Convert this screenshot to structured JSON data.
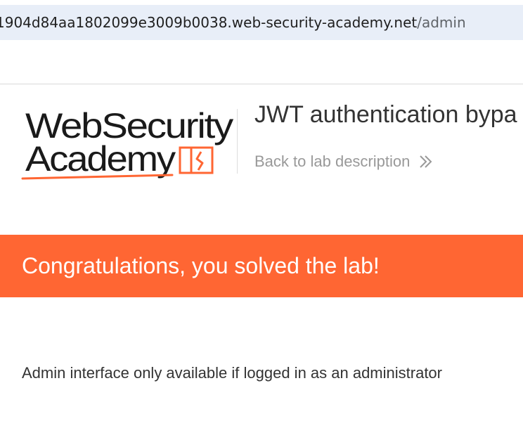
{
  "browser": {
    "url_host": "1904d84aa1802099e3009b0038.web-security-academy.net",
    "url_path": "/admin"
  },
  "header": {
    "logo": {
      "line1": "WebSecurity",
      "line2": "Academy",
      "icon": "academy-logo-icon"
    },
    "lab_title": "JWT authentication bypa",
    "back_link": "Back to lab description",
    "back_icon": "double-chevron-right-icon"
  },
  "banner": {
    "text": "Congratulations, you solved the lab!",
    "color": "#ff6633"
  },
  "main": {
    "message": "Admin interface only available if logged in as an administrator"
  },
  "colors": {
    "accent": "#ff6633",
    "text": "#333333",
    "muted": "#999999"
  }
}
